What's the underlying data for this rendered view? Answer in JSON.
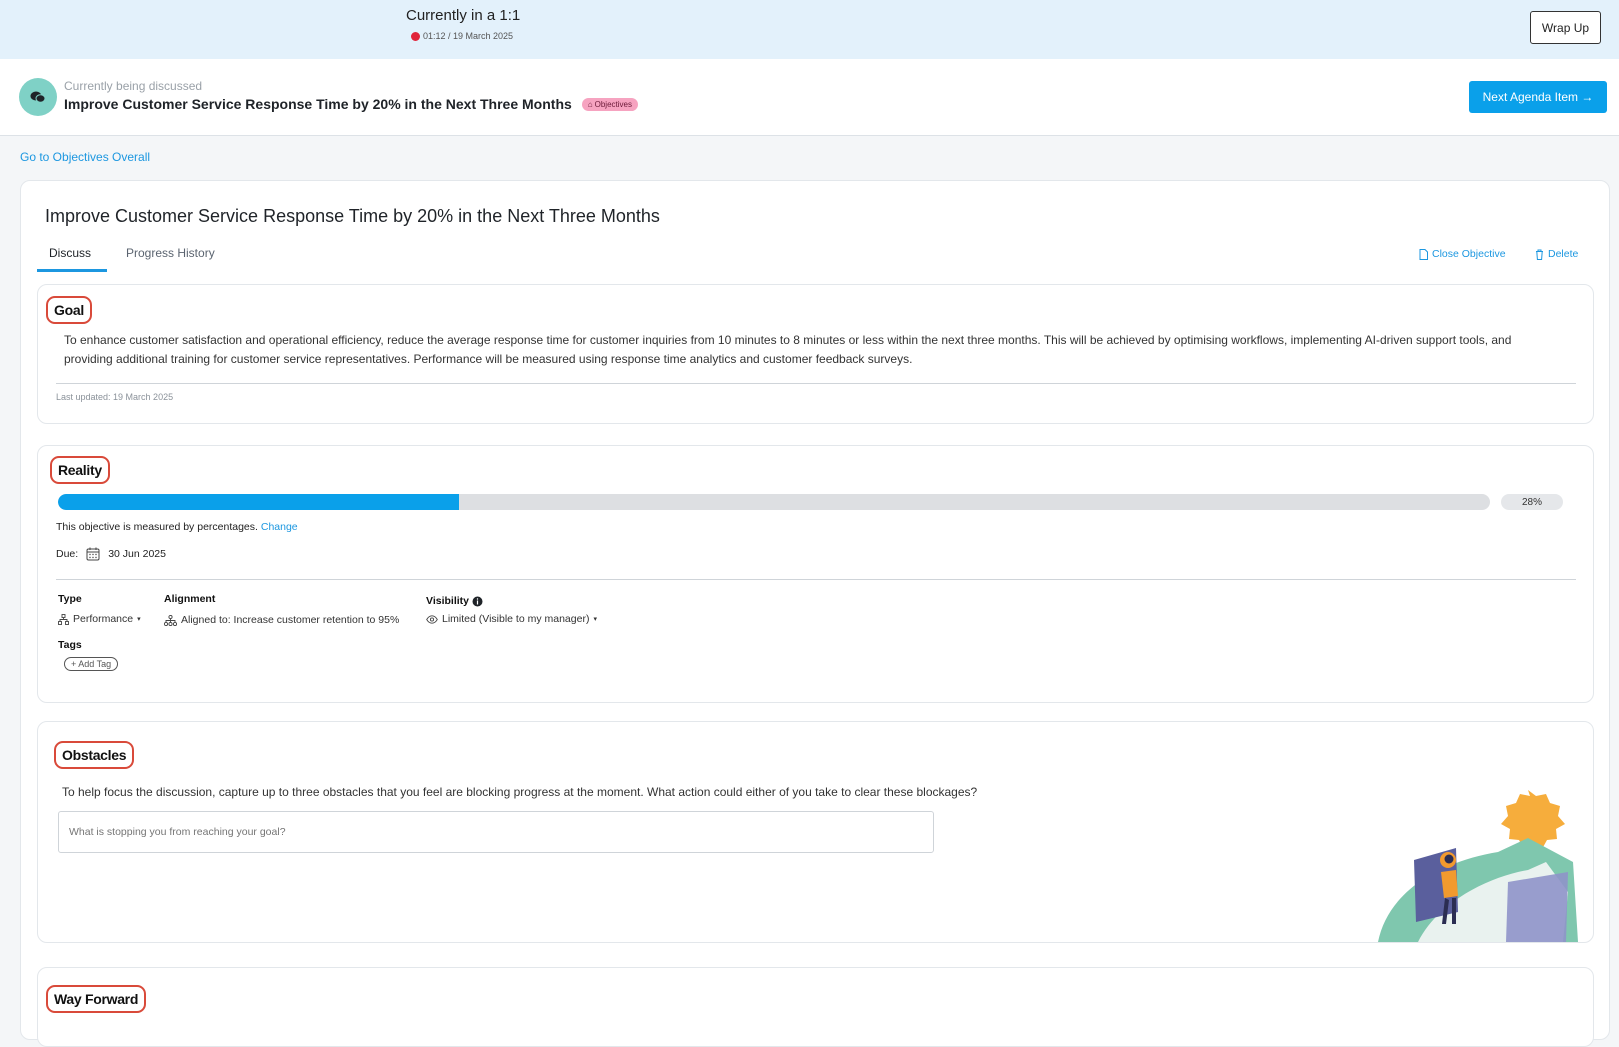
{
  "meeting": {
    "title": "Currently in a 1:1",
    "timer": "01:12 / 19 March 2025",
    "wrap_up_label": "Wrap Up"
  },
  "discussion": {
    "label": "Currently being discussed",
    "title": "Improve Customer Service Response Time by 20% in the Next Three Months",
    "badge": "Objectives",
    "next_label": "Next Agenda Item →"
  },
  "goto_link": "Go to Objectives Overall",
  "objective": {
    "title": "Improve Customer Service Response Time by 20% in the Next Three Months",
    "tabs": [
      "Discuss",
      "Progress History"
    ],
    "active_tab": "Discuss",
    "close_label": "Close Objective",
    "delete_label": "Delete"
  },
  "goal": {
    "heading": "Goal",
    "text": "To enhance customer satisfaction and operational efficiency, reduce the average response time for customer inquiries from 10 minutes to 8 minutes or less within the next three months. This will be achieved by optimising workflows, implementing AI-driven support tools, and providing additional training for customer service representatives. Performance will be measured using response time analytics and customer feedback surveys.",
    "updated": "Last updated: 19 March 2025"
  },
  "reality": {
    "heading": "Reality",
    "progress_percent": 28,
    "progress_label": "28%",
    "measure_text": "This objective is measured by percentages.",
    "change_label": "Change",
    "due_label": "Due:",
    "due_date": "30 Jun 2025",
    "type_label": "Type",
    "type_value": "Performance",
    "alignment_label": "Alignment",
    "alignment_value": "Aligned to: Increase customer retention to 95%",
    "visibility_label": "Visibility",
    "visibility_value": "Limited (Visible to my manager)",
    "tags_label": "Tags",
    "add_tag_label": "+ Add Tag"
  },
  "obstacles": {
    "heading": "Obstacles",
    "prompt": "To help focus the discussion, capture up to three obstacles that you feel are blocking progress at the moment. What action could either of you take to clear these blockages?",
    "placeholder": "What is stopping you from reaching your goal?"
  },
  "way_forward": {
    "heading": "Way Forward"
  },
  "colors": {
    "accent": "#0aa0ea",
    "header_bg": "#e3f1fb",
    "badge_pink": "#f6a3c0",
    "highlight_red": "#d94a3a",
    "recording_red": "#e0243a"
  }
}
